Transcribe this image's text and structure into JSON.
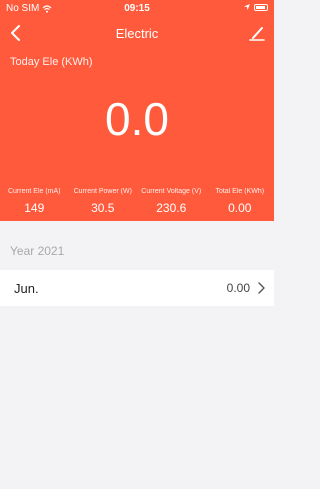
{
  "status": {
    "carrier": "No SIM",
    "time": "09:15"
  },
  "nav": {
    "title": "Electric"
  },
  "hero": {
    "label": "Today Ele (KWh)",
    "value": "0.0",
    "stats": [
      {
        "label": "Current Ele (mA)",
        "value": "149"
      },
      {
        "label": "Current Power (W)",
        "value": "30.5"
      },
      {
        "label": "Current Voltage (V)",
        "value": "230.6"
      },
      {
        "label": "Total Ele (KWh)",
        "value": "0.00"
      }
    ]
  },
  "history": {
    "year_label": "Year 2021",
    "months": [
      {
        "month": "Jun.",
        "value": "0.00"
      }
    ]
  },
  "colors": {
    "accent": "#ff5a3c",
    "background": "#f3f3f5"
  },
  "icons": [
    "wifi-icon",
    "location-icon",
    "battery-icon",
    "back-chevron-icon",
    "edit-icon",
    "chevron-right-icon"
  ]
}
